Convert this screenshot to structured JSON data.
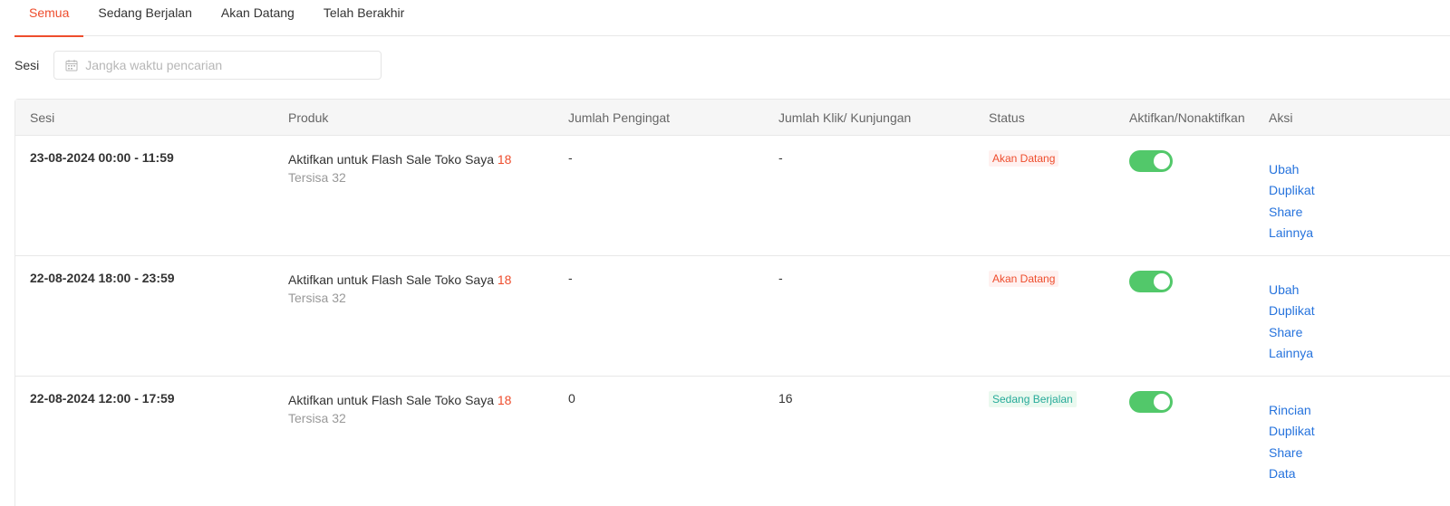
{
  "tabs": [
    {
      "label": "Semua",
      "active": true
    },
    {
      "label": "Sedang Berjalan",
      "active": false
    },
    {
      "label": "Akan Datang",
      "active": false
    },
    {
      "label": "Telah Berakhir",
      "active": false
    }
  ],
  "filter": {
    "label": "Sesi",
    "placeholder": "Jangka waktu pencarian",
    "icon": "calendar-icon"
  },
  "table": {
    "headers": [
      "Sesi",
      "Produk",
      "Jumlah Pengingat",
      "Jumlah Klik/ Kunjungan",
      "Status",
      "Aktifkan/Nonaktifkan",
      "Aksi"
    ],
    "rows": [
      {
        "sesi": "23-08-2024 00:00 - 11:59",
        "produk_label": "Aktifkan untuk Flash Sale Toko Saya",
        "produk_count": "18",
        "produk_sub": "Tersisa 32",
        "pengingat": "-",
        "klik": "-",
        "status": "Akan Datang",
        "enabled": true,
        "actions": [
          "Ubah",
          "Duplikat",
          "Share",
          "Lainnya"
        ]
      },
      {
        "sesi": "22-08-2024 18:00 - 23:59",
        "produk_label": "Aktifkan untuk Flash Sale Toko Saya",
        "produk_count": "18",
        "produk_sub": "Tersisa 32",
        "pengingat": "-",
        "klik": "-",
        "status": "Akan Datang",
        "enabled": true,
        "actions": [
          "Ubah",
          "Duplikat",
          "Share",
          "Lainnya"
        ]
      },
      {
        "sesi": "22-08-2024 12:00 - 17:59",
        "produk_label": "Aktifkan untuk Flash Sale Toko Saya",
        "produk_count": "18",
        "produk_sub": "Tersisa 32",
        "pengingat": "0",
        "klik": "16",
        "status": "Sedang Berjalan",
        "enabled": true,
        "actions": [
          "Rincian",
          "Duplikat",
          "Share",
          "Data"
        ]
      }
    ]
  },
  "colors": {
    "accent": "#ee4d2d",
    "link": "#2673dd",
    "toggle_on": "#52c86a",
    "status_upcoming": "#ee4d2d",
    "status_ongoing": "#26aa99"
  }
}
